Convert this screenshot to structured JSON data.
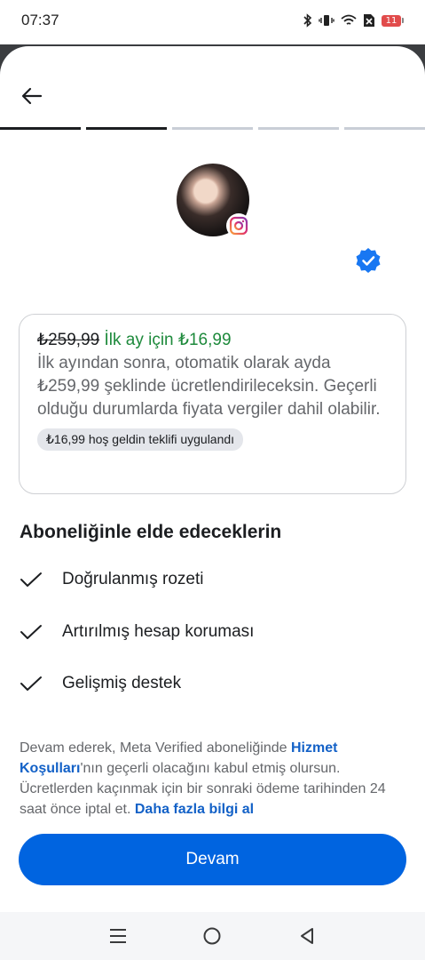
{
  "status_bar": {
    "time": "07:37",
    "battery_level": "11",
    "icons": [
      "bluetooth-icon",
      "vibrate-icon",
      "wifi-icon",
      "no-sim-icon",
      "battery-icon"
    ]
  },
  "progress": {
    "total_steps": 5,
    "completed_steps": 2
  },
  "offer": {
    "old_price": "₺259,99",
    "new_price": "İlk ay için ₺16,99",
    "description": "İlk ayından sonra, otomatik olarak ayda ₺259,99 şeklinde ücretlendirileceksin. Geçerli olduğu durumlarda fiyata vergiler dahil olabilir.",
    "pill": "₺16,99 hoş geldin teklifi uygulandı"
  },
  "benefits": {
    "title": "Aboneliğinle elde edeceklerin",
    "items": [
      {
        "label": "Doğrulanmış rozeti"
      },
      {
        "label": "Artırılmış hesap koruması"
      },
      {
        "label": "Gelişmiş destek"
      }
    ]
  },
  "legal": {
    "text_1": "Devam ederek, Meta Verified aboneliğinde ",
    "link_terms": "Hizmet Koşulları",
    "text_2": "'nın geçerli olacağını kabul etmiş olursun. Ücretlerden kaçınmak için bir sonraki ödeme tarihinden 24 saat önce iptal et. ",
    "link_more": "Daha fazla bilgi al"
  },
  "continue_button": {
    "label": "Devam"
  },
  "colors": {
    "primary": "#0064e0",
    "price_green": "#1e8a3c",
    "link": "#1361c7",
    "verified_badge": "#1877f2"
  }
}
